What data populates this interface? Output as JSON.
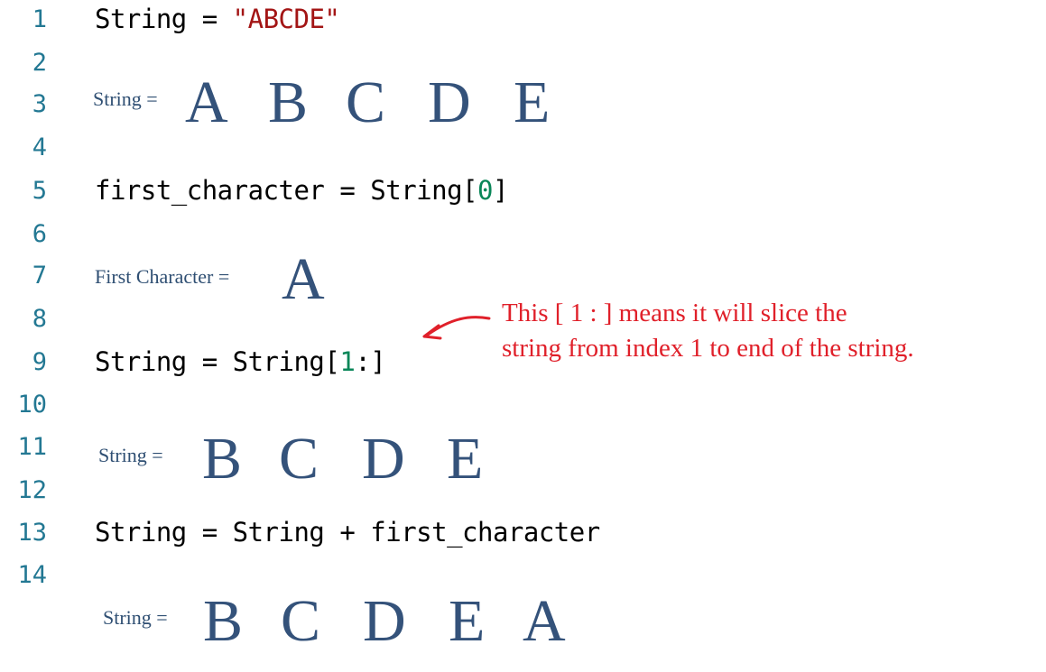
{
  "line_numbers": [
    "1",
    "2",
    "3",
    "4",
    "5",
    "6",
    "7",
    "8",
    "9",
    "10",
    "11",
    "12",
    "13",
    "14"
  ],
  "code": {
    "line1": {
      "var": "String",
      "op": " = ",
      "literal": "\"ABCDE\""
    },
    "line5": {
      "prefix": "first_character = String[",
      "index": "0",
      "suffix": "]"
    },
    "line9": {
      "prefix": "String = String[",
      "index": "1",
      "suffix": ":]"
    },
    "line13": {
      "text": "String = String + first_character"
    }
  },
  "visuals": {
    "v1": {
      "label": "String =",
      "chars": [
        "A",
        "B",
        "C",
        "D",
        "E"
      ]
    },
    "v2": {
      "label": "First Character =",
      "chars": [
        "A"
      ]
    },
    "v3": {
      "label": "String =",
      "chars": [
        "B",
        "C",
        "D",
        "E"
      ]
    },
    "v4": {
      "label": "String =",
      "chars": [
        "B",
        "C",
        "D",
        "E",
        "A"
      ]
    }
  },
  "annotation": {
    "line1": "This [ 1 : ] means it will slice the",
    "line2": "string from index 1 to end of the string."
  },
  "colors": {
    "line_number": "#237893",
    "string_literal": "#a31515",
    "number_literal": "#098658",
    "annotation": "#e0202a",
    "visual_text": "#34527a"
  }
}
